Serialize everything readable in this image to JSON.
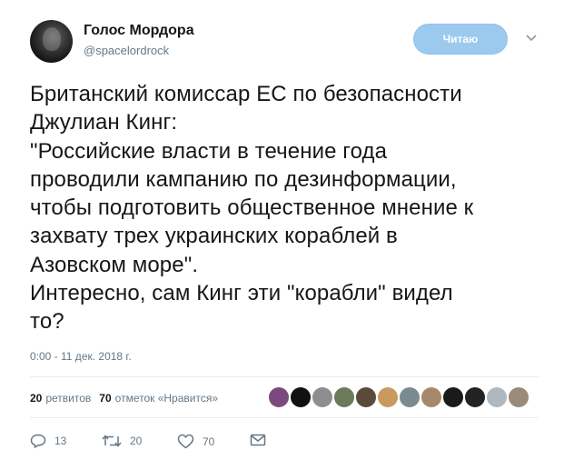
{
  "author": {
    "display_name": "Голос Мордора",
    "handle": "@spacelordrock",
    "avatar_icon": "user-avatar"
  },
  "follow_button": {
    "label": "Читаю"
  },
  "tweet": {
    "lines": [
      "Британский комиссар ЕС по безопасности",
      "Джулиан Кинг:",
      "\"Российские власти в течение года",
      "проводили кампанию по дезинформации,",
      "чтобы подготовить общественное мнение к",
      "захвату трех украинских кораблей в",
      "Азовском море\".",
      "Интересно, сам Кинг эти \"корабли\" видел",
      "то?"
    ],
    "timestamp": "0:00 - 11 дек. 2018 г."
  },
  "stats": {
    "retweets_count": "20",
    "retweets_label": "ретвитов",
    "likes_count": "70",
    "likes_label": "отметок «Нравится»"
  },
  "liker_avatars": [
    "#7a4a7e",
    "#111111",
    "#8e8e8e",
    "#6a7a5a",
    "#5a4a3a",
    "#c89a60",
    "#7a8a90",
    "#a8886a",
    "#1a1a1a",
    "#222222",
    "#b0b8bf",
    "#9a8a7a"
  ],
  "actions": {
    "reply_count": "13",
    "retweet_count": "20",
    "like_count": "70"
  },
  "colors": {
    "text": "#14171a",
    "secondary": "#657786",
    "follow_button_bg": "#9cc9ee",
    "divider": "#e6ecf0"
  },
  "icons": [
    "chevron-down-icon",
    "reply-icon",
    "retweet-icon",
    "heart-icon",
    "message-icon"
  ]
}
